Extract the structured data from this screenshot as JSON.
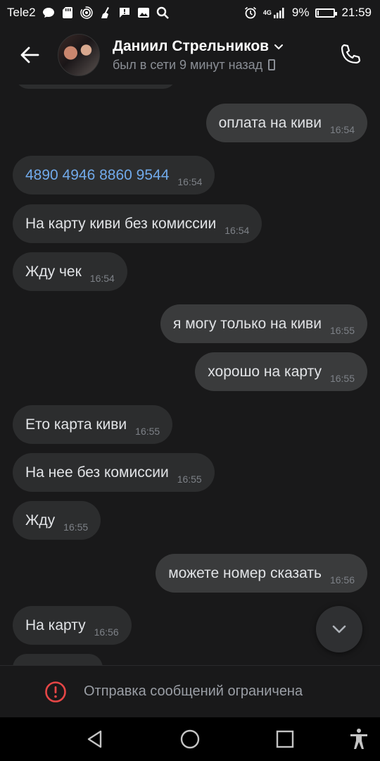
{
  "status_bar": {
    "carrier": "Tele2",
    "network": "4G",
    "battery": "9%",
    "battery_level": 0.09,
    "time": "21:59",
    "icons": [
      "chat-bubble-icon",
      "sd-card-icon",
      "hotspot-icon",
      "cleaner-icon",
      "message-icon",
      "gallery-icon",
      "search-icon",
      "alarm-icon",
      "signal-icon",
      "battery-icon"
    ]
  },
  "header": {
    "contact_name": "Даниил Стрельников",
    "last_seen": "был в сети 9 минут назад"
  },
  "messages": [
    {
      "dir": "out",
      "text": "оплата на киви",
      "time": "16:54"
    },
    {
      "dir": "in",
      "text": "4890 4946 8860 9544",
      "time": "16:54",
      "link": true
    },
    {
      "dir": "in",
      "text": "На карту киви без комиссии",
      "time": "16:54"
    },
    {
      "dir": "in",
      "text": "Жду чек",
      "time": "16:54"
    },
    {
      "dir": "out",
      "text": "я могу только на киви",
      "time": "16:55"
    },
    {
      "dir": "out",
      "text": "хорошо на карту",
      "time": "16:55"
    },
    {
      "dir": "in",
      "text": "Ето карта киви",
      "time": "16:55"
    },
    {
      "dir": "in",
      "text": "На нее без комиссии",
      "time": "16:55"
    },
    {
      "dir": "in",
      "text": "Жду",
      "time": "16:55"
    },
    {
      "dir": "out",
      "text": "можете номер сказать",
      "time": "16:56"
    },
    {
      "dir": "in",
      "text": "На карту",
      "time": "16:56"
    }
  ],
  "restriction": {
    "text": "Отправка сообщений ограничена"
  },
  "colors": {
    "background": "#19191a",
    "bubble_in": "#2c2d2e",
    "bubble_out": "#3a3b3c",
    "link": "#71aaeb",
    "warning": "#e64646"
  }
}
